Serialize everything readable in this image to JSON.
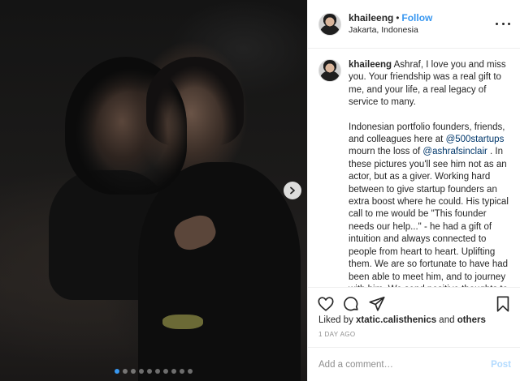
{
  "post": {
    "carousel": {
      "dot_count": 10,
      "active_index": 0,
      "next_icon": "chevron-right-icon"
    }
  },
  "header": {
    "username": "khaileeng",
    "separator": "•",
    "follow_label": "Follow",
    "location": "Jakarta, Indonesia"
  },
  "caption": {
    "username": "khaileeng",
    "text_1": "Ashraf, I love you and miss you. Your friendship was a real gift to me, and your life, a real legacy of service to many.",
    "text_2a": "Indonesian portfolio founders, friends, and colleagues here at ",
    "mention_1": "@500startups",
    "text_2b": " mourn the loss of ",
    "mention_2": "@ashrafsinclair",
    "text_2c": " . In these pictures you'll see him not as an actor, but as a giver. Working hard between to give startup founders an extra boost where he could. His typical call to me would be \"This founder needs our help...\" - he had a gift of intuition and always connected to people from heart to heart. Uplifting them. We are so fortunate to have had been able to meet him, and to journey with him. We send positive thoughts to his family. We will live on with the"
  },
  "actions": {
    "like_icon": "heart-icon",
    "comment_icon": "comment-icon",
    "share_icon": "paper-plane-icon",
    "save_icon": "bookmark-icon"
  },
  "likes": {
    "prefix": "Liked by ",
    "user": "xtatic.calisthenics",
    "middle": " and ",
    "others": "others"
  },
  "timestamp": "1 DAY AGO",
  "comment": {
    "placeholder": "Add a comment…",
    "post_label": "Post"
  },
  "colors": {
    "accent": "#3897f0",
    "mention": "#00376b",
    "post_disabled": "#b3dbff"
  }
}
